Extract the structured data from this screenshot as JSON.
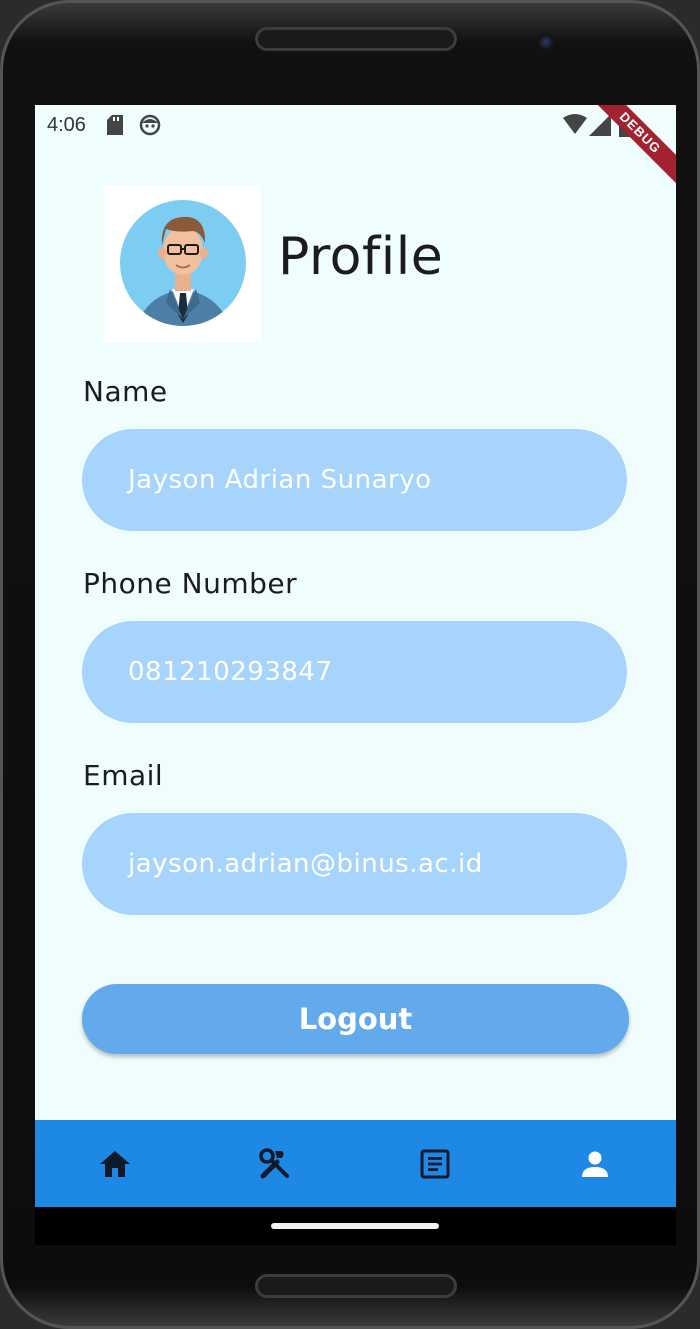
{
  "status_bar": {
    "time": "4:06",
    "icons": [
      "sd-card-icon",
      "face-icon",
      "wifi-icon",
      "signal-icon",
      "battery-icon"
    ]
  },
  "debug_banner": "DEBUG",
  "header": {
    "title": "Profile",
    "avatar": "profile-avatar-illustration"
  },
  "form": {
    "name_label": "Name",
    "name_value": "Jayson Adrian Sunaryo",
    "phone_label": "Phone Number",
    "phone_value": "081210293847",
    "email_label": "Email",
    "email_value": "jayson.adrian@binus.ac.id"
  },
  "logout_label": "Logout",
  "bottom_nav": {
    "items": [
      {
        "icon": "home-icon"
      },
      {
        "icon": "tools-icon"
      },
      {
        "icon": "article-icon"
      },
      {
        "icon": "person-icon"
      }
    ]
  },
  "colors": {
    "background": "#f0fdfd",
    "field": "#a6d4fb",
    "button": "#63aaed",
    "nav": "#1e88e5"
  }
}
